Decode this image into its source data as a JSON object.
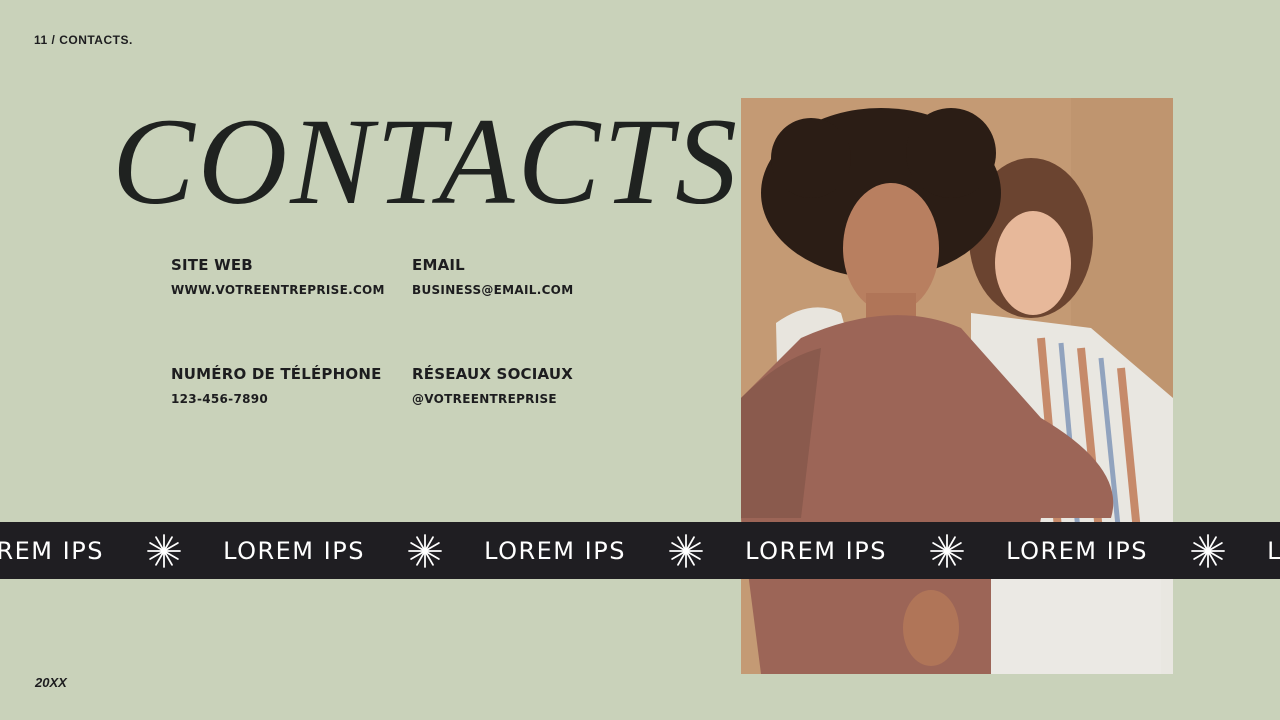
{
  "slide_label": "11 / CONTACTS.",
  "title": "CONTACTS",
  "contacts": {
    "website": {
      "heading": "SITE WEB",
      "value": "WWW.VOTREENTREPRISE.COM"
    },
    "email": {
      "heading": "EMAIL",
      "value": "BUSINESS@EMAIL.COM"
    },
    "phone": {
      "heading": "NUMÉRO DE TÉLÉPHONE",
      "value": "123-456-7890"
    },
    "social": {
      "heading": "RÉSEAUX SOCIAUX",
      "value": "@VOTREENTREPRISE"
    }
  },
  "ticker": {
    "items": [
      "LOREM IPS",
      "LOREM IPS",
      "LOREM IPS",
      "LOREM IPS",
      "LOREM IPS",
      "LOREM IPS"
    ],
    "separator_icon": "sparkle-star-icon"
  },
  "photo": {
    "subject": "two-women-portrait-photo"
  },
  "footer_year": "20XX",
  "colors": {
    "background": "#c9d2ba",
    "ticker_bg": "#1f1e22",
    "ticker_text": "#ffffff",
    "photo_backdrop": "#c49a74",
    "text": "#1d1d1f"
  }
}
